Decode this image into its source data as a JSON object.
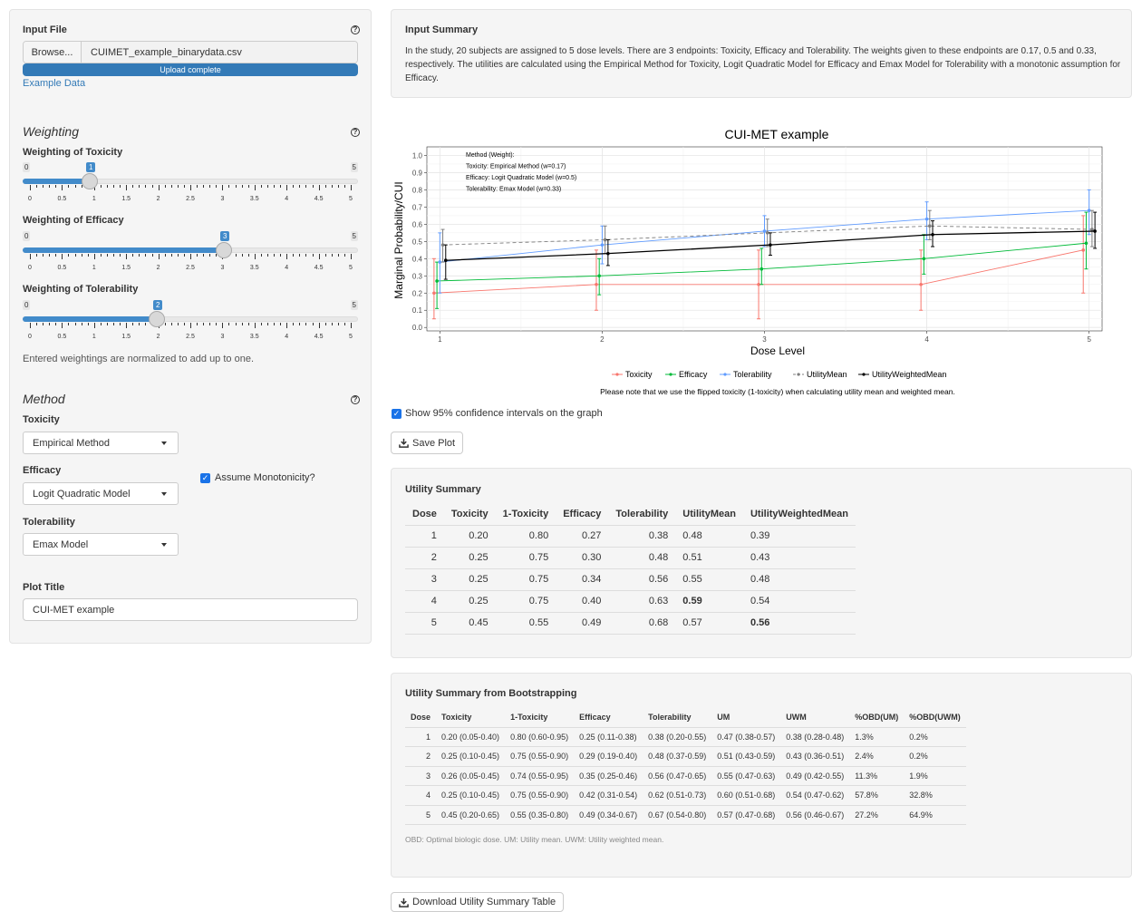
{
  "sidebar": {
    "input_file": {
      "label": "Input File",
      "browse_label": "Browse...",
      "file_name": "CUIMET_example_binarydata.csv",
      "progress_text": "Upload complete",
      "example_link": "Example Data"
    },
    "weighting": {
      "title": "Weighting",
      "sliders": [
        {
          "label": "Weighting of Toxicity",
          "value": 1,
          "value_text": "1",
          "min": "0",
          "max": "5"
        },
        {
          "label": "Weighting of Efficacy",
          "value": 3,
          "value_text": "3",
          "min": "0",
          "max": "5"
        },
        {
          "label": "Weighting of Tolerability",
          "value": 2,
          "value_text": "2",
          "min": "0",
          "max": "5"
        }
      ],
      "tick_labels": [
        "0",
        "0.5",
        "1",
        "1.5",
        "2",
        "2.5",
        "3",
        "3.5",
        "4",
        "4.5",
        "5"
      ],
      "note": "Entered weightings are normalized to add up to one."
    },
    "method": {
      "title": "Method",
      "toxicity_label": "Toxicity",
      "toxicity_value": "Empirical Method",
      "efficacy_label": "Efficacy",
      "efficacy_value": "Logit Quadratic Model",
      "monotonic_label": "Assume Monotonicity?",
      "monotonic_checked": true,
      "tolerability_label": "Tolerability",
      "tolerability_value": "Emax Model"
    },
    "plot_title": {
      "label": "Plot Title",
      "value": "CUI-MET example"
    }
  },
  "input_summary": {
    "title": "Input Summary",
    "text": "In the study, 20 subjects are assigned to 5 dose levels. There are 3 endpoints: Toxicity, Efficacy and Tolerability. The weights given to these endpoints are 0.17, 0.5 and 0.33, respectively. The utilities are calculated using the Empirical Method for Toxicity, Logit Quadratic Model for Efficacy and Emax Model for Tolerability with a monotonic assumption for Efficacy."
  },
  "chart_data": {
    "type": "line",
    "title": "CUI-MET example",
    "xlabel": "Dose Level",
    "ylabel": "Marginal Probability/CUI",
    "x": [
      1,
      2,
      3,
      4,
      5
    ],
    "xlim": [
      0.92,
      5.08
    ],
    "ylim": [
      -0.02,
      1.05
    ],
    "yticks": [
      "0.0",
      "0.1",
      "0.2",
      "0.3",
      "0.4",
      "0.5",
      "0.6",
      "0.7",
      "0.8",
      "0.9",
      "1.0"
    ],
    "xticks": [
      "1",
      "2",
      "3",
      "4",
      "5"
    ],
    "grid": true,
    "annotation": [
      "Method (Weight):",
      "Toxicity: Empirical Method (w=0.17)",
      "Efficacy: Logit Quadratic Model (w=0.5)",
      "Tolerability: Emax Model (w=0.33)"
    ],
    "series": [
      {
        "name": "Toxicity",
        "color": "#f8766d",
        "dash": false,
        "values": [
          0.2,
          0.25,
          0.25,
          0.25,
          0.45
        ],
        "ci": [
          [
            0.05,
            0.4
          ],
          [
            0.1,
            0.45
          ],
          [
            0.05,
            0.45
          ],
          [
            0.1,
            0.45
          ],
          [
            0.2,
            0.65
          ]
        ]
      },
      {
        "name": "Efficacy",
        "color": "#00ba38",
        "dash": false,
        "values": [
          0.27,
          0.3,
          0.34,
          0.4,
          0.49
        ],
        "ci": [
          [
            0.11,
            0.38
          ],
          [
            0.19,
            0.4
          ],
          [
            0.25,
            0.46
          ],
          [
            0.31,
            0.54
          ],
          [
            0.34,
            0.67
          ]
        ]
      },
      {
        "name": "Tolerability",
        "color": "#619cff",
        "dash": false,
        "values": [
          0.38,
          0.48,
          0.56,
          0.63,
          0.68
        ],
        "ci": [
          [
            0.2,
            0.55
          ],
          [
            0.37,
            0.59
          ],
          [
            0.47,
            0.65
          ],
          [
            0.51,
            0.73
          ],
          [
            0.54,
            0.8
          ]
        ]
      },
      {
        "name": "UtilityMean",
        "color": "#7f7f7f",
        "dash": true,
        "values": [
          0.48,
          0.51,
          0.55,
          0.59,
          0.57
        ],
        "ci": [
          [
            0.38,
            0.57
          ],
          [
            0.43,
            0.59
          ],
          [
            0.47,
            0.63
          ],
          [
            0.51,
            0.68
          ],
          [
            0.47,
            0.68
          ]
        ]
      },
      {
        "name": "UtilityWeightedMean",
        "color": "#000000",
        "dash": false,
        "values": [
          0.39,
          0.43,
          0.48,
          0.54,
          0.56
        ],
        "ci": [
          [
            0.28,
            0.48
          ],
          [
            0.36,
            0.51
          ],
          [
            0.42,
            0.55
          ],
          [
            0.47,
            0.62
          ],
          [
            0.46,
            0.67
          ]
        ]
      }
    ],
    "note": "Please note that we use the flipped toxicity (1-toxicity) when calculating utility mean and weighted mean."
  },
  "ci_checkbox": {
    "label": "Show 95% confidence intervals on the graph",
    "checked": true
  },
  "save_plot_label": "Save Plot",
  "utility_summary": {
    "title": "Utility Summary",
    "headers": [
      "Dose",
      "Toxicity",
      "1-Toxicity",
      "Efficacy",
      "Tolerability",
      "UtilityMean",
      "UtilityWeightedMean"
    ],
    "rows": [
      [
        "1",
        "0.20",
        "0.80",
        "0.27",
        "0.38",
        "0.48",
        "0.39"
      ],
      [
        "2",
        "0.25",
        "0.75",
        "0.30",
        "0.48",
        "0.51",
        "0.43"
      ],
      [
        "3",
        "0.25",
        "0.75",
        "0.34",
        "0.56",
        "0.55",
        "0.48"
      ],
      [
        "4",
        "0.25",
        "0.75",
        "0.40",
        "0.63",
        "0.59",
        "0.54"
      ],
      [
        "5",
        "0.45",
        "0.55",
        "0.49",
        "0.68",
        "0.57",
        "0.56"
      ]
    ],
    "highlight_color": "#e00000"
  },
  "boot_summary": {
    "title": "Utility Summary from Bootstrapping",
    "headers": [
      "Dose",
      "Toxicity",
      "1-Toxicity",
      "Efficacy",
      "Tolerability",
      "UM",
      "UWM",
      "%OBD(UM)",
      "%OBD(UWM)"
    ],
    "rows": [
      [
        "1",
        "0.20 (0.05-0.40)",
        "0.80 (0.60-0.95)",
        "0.25 (0.11-0.38)",
        "0.38 (0.20-0.55)",
        "0.47 (0.38-0.57)",
        "0.38 (0.28-0.48)",
        "1.3%",
        "0.2%"
      ],
      [
        "2",
        "0.25 (0.10-0.45)",
        "0.75 (0.55-0.90)",
        "0.29 (0.19-0.40)",
        "0.48 (0.37-0.59)",
        "0.51 (0.43-0.59)",
        "0.43 (0.36-0.51)",
        "2.4%",
        "0.2%"
      ],
      [
        "3",
        "0.26 (0.05-0.45)",
        "0.74 (0.55-0.95)",
        "0.35 (0.25-0.46)",
        "0.56 (0.47-0.65)",
        "0.55 (0.47-0.63)",
        "0.49 (0.42-0.55)",
        "11.3%",
        "1.9%"
      ],
      [
        "4",
        "0.25 (0.10-0.45)",
        "0.75 (0.55-0.90)",
        "0.42 (0.31-0.54)",
        "0.62 (0.51-0.73)",
        "0.60 (0.51-0.68)",
        "0.54 (0.47-0.62)",
        "57.8%",
        "32.8%"
      ],
      [
        "5",
        "0.45 (0.20-0.65)",
        "0.55 (0.35-0.80)",
        "0.49 (0.34-0.67)",
        "0.67 (0.54-0.80)",
        "0.57 (0.47-0.68)",
        "0.56 (0.46-0.67)",
        "27.2%",
        "64.9%"
      ]
    ],
    "footnote": "OBD: Optimal biologic dose. UM: Utility mean. UWM: Utility weighted mean."
  },
  "download_label": "Download Utility Summary Table"
}
